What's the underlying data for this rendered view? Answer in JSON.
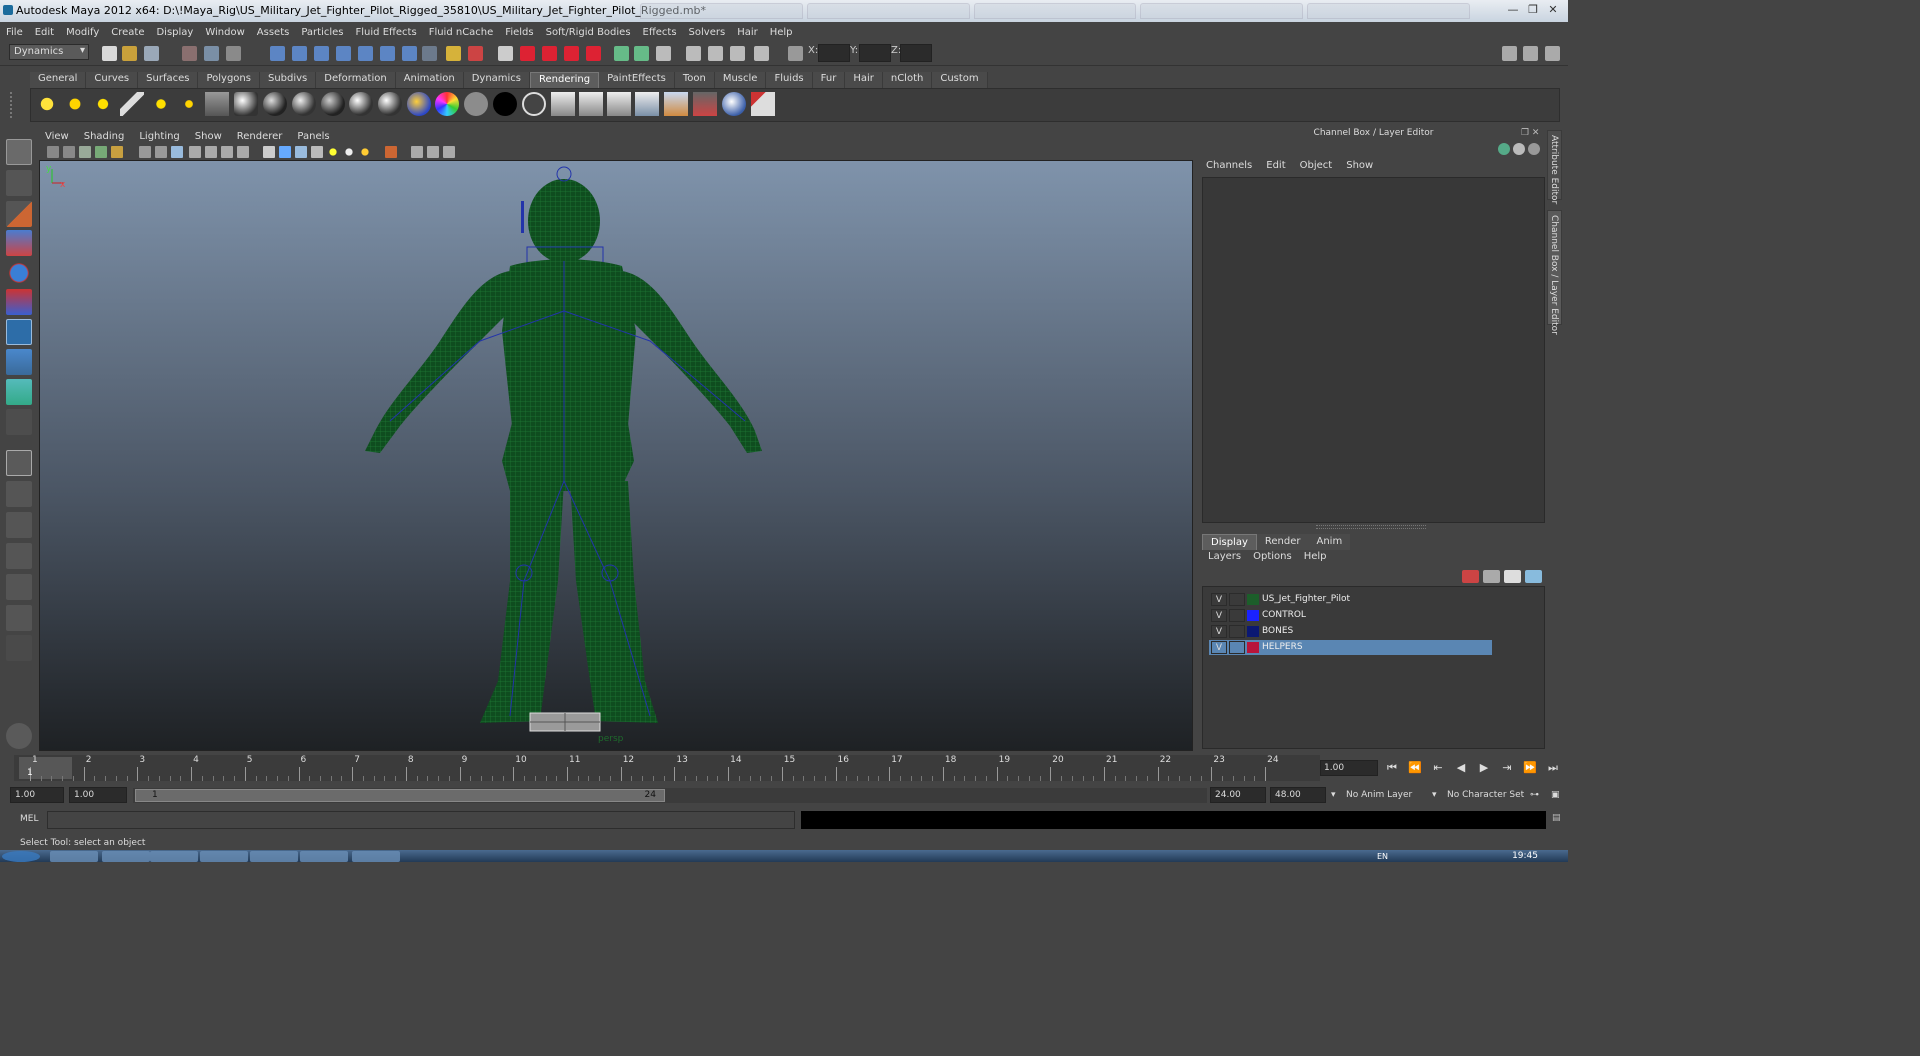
{
  "window": {
    "title": "Autodesk Maya 2012 x64: D:\\!Maya_Rig\\US_Military_Jet_Fighter_Pilot_Rigged_35810\\US_Military_Jet_Fighter_Pilot_Rigged.mb*",
    "controls": [
      "—",
      "❐",
      "✕"
    ]
  },
  "menubar": [
    "File",
    "Edit",
    "Modify",
    "Create",
    "Display",
    "Window",
    "Assets",
    "Particles",
    "Fluid Effects",
    "Fluid nCache",
    "Fields",
    "Soft/Rigid Bodies",
    "Effects",
    "Solvers",
    "Hair",
    "Help"
  ],
  "statusline": {
    "menu_set": "Dynamics",
    "x_label": "X:",
    "y_label": "Y:",
    "z_label": "Z:"
  },
  "shelf": {
    "tabs": [
      "General",
      "Curves",
      "Surfaces",
      "Polygons",
      "Subdivs",
      "Deformation",
      "Animation",
      "Dynamics",
      "Rendering",
      "PaintEffects",
      "Toon",
      "Muscle",
      "Fluids",
      "Fur",
      "Hair",
      "nCloth",
      "Custom"
    ],
    "active_tab": "Rendering",
    "icons": [
      "ambient-light-icon",
      "directional-light-icon",
      "point-light-icon",
      "spot-light-icon",
      "area-light-icon",
      "volume-light-icon",
      "render-settings-icon",
      "blinn-sphere-icon",
      "lambert-sphere-icon",
      "phong-sphere-icon",
      "phonge-sphere-icon",
      "anisotropic-sphere-icon",
      "layered-shader-icon",
      "ramp-shader-icon",
      "surface-shader-gray-icon",
      "surface-shader-black-icon",
      "use-background-icon",
      "render-icon",
      "ipr-render-icon",
      "batch-render-icon",
      "hypershade-icon",
      "render-view-icon",
      "render-layer-icon",
      "mental-ray-icon",
      "paint-icon"
    ]
  },
  "viewport": {
    "menu": [
      "View",
      "Shading",
      "Lighting",
      "Show",
      "Renderer",
      "Panels"
    ],
    "camera_label": "persp",
    "axis_y": "y",
    "axis_x": "x"
  },
  "channel_box": {
    "title": "Channel Box / Layer Editor",
    "menu": [
      "Channels",
      "Edit",
      "Object",
      "Show"
    ]
  },
  "side_tabs": [
    "Attribute Editor",
    "Channel Box / Layer Editor"
  ],
  "layer_editor": {
    "tabs": [
      "Display",
      "Render",
      "Anim"
    ],
    "active_tab": "Display",
    "menu": [
      "Layers",
      "Options",
      "Help"
    ],
    "layers": [
      {
        "visible": "V",
        "name": "US_Jet_Fighter_Pilot",
        "color": "#1c5e2a",
        "selected": false
      },
      {
        "visible": "V",
        "name": "CONTROL",
        "color": "#1a22ff",
        "selected": false
      },
      {
        "visible": "V",
        "name": "BONES",
        "color": "#0b1873",
        "selected": false
      },
      {
        "visible": "V",
        "name": "HELPERS",
        "color": "#b8143a",
        "selected": true
      }
    ]
  },
  "time_slider": {
    "ticks": [
      "1",
      "2",
      "3",
      "4",
      "5",
      "6",
      "7",
      "8",
      "9",
      "10",
      "11",
      "12",
      "13",
      "14",
      "15",
      "16",
      "17",
      "18",
      "19",
      "20",
      "21",
      "22",
      "23",
      "24"
    ],
    "current_frame": "1",
    "current_time_field": "1.00",
    "playback_controls": [
      "⏮",
      "⏪",
      "⇤",
      "◀",
      "▶",
      "⇥",
      "⏩",
      "⏭"
    ]
  },
  "range_slider": {
    "start_time": "1.00",
    "playback_start": "1.00",
    "range_start_label": "1",
    "range_end_label": "24",
    "playback_end": "24.00",
    "end_time": "48.00",
    "anim_layer": "No Anim Layer",
    "character_set": "No Character Set"
  },
  "command_line": {
    "label": "MEL"
  },
  "help_line": {
    "text": "Select Tool: select an object"
  },
  "taskbar": {
    "lang": "EN",
    "clock": "19:45"
  },
  "colors": {
    "mesh_wire": "#0f5a22",
    "bone": "#2233aa",
    "selection_highlight": "#5a86b3",
    "ui_background": "#444444"
  }
}
